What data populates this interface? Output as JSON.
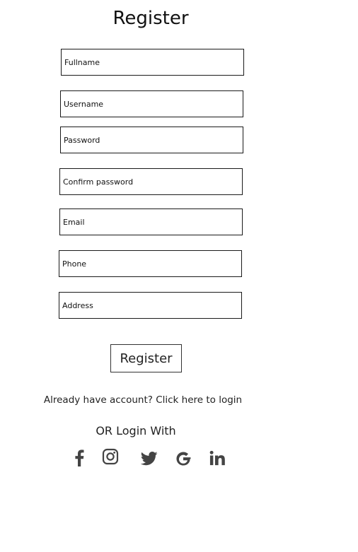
{
  "page": {
    "title": "Register"
  },
  "form": {
    "fullname_placeholder": "Fullname",
    "username_placeholder": "Username",
    "password_placeholder": "Password",
    "confirm_password_placeholder": "Confirm password",
    "email_placeholder": "Email",
    "phone_placeholder": "Phone",
    "address_placeholder": "Address",
    "submit_label": "Register"
  },
  "login": {
    "prefix": "Already have account? ",
    "link_text": "Click here to login"
  },
  "social": {
    "heading": "OR Login With",
    "icons": [
      "facebook-icon",
      "instagram-icon",
      "twitter-icon",
      "google-icon",
      "linkedin-icon"
    ],
    "icon_color": "#444444"
  }
}
